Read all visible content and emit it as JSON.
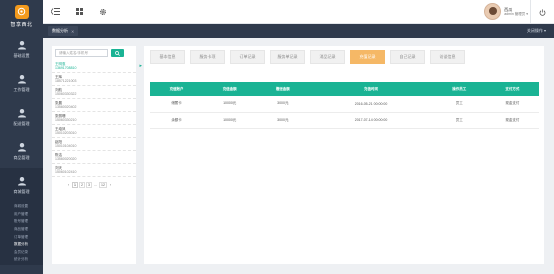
{
  "app": {
    "logo_text": "智享西北"
  },
  "sidebar": {
    "items": [
      {
        "label": "基础设置",
        "icon": "user-icon"
      },
      {
        "label": "工作管理",
        "icon": "user-icon"
      },
      {
        "label": "配送管理",
        "icon": "user-icon"
      },
      {
        "label": "商品管理",
        "icon": "user-icon"
      },
      {
        "label": "商城管理",
        "icon": "user-icon"
      }
    ],
    "submenu": [
      {
        "label": "商城设置",
        "active": false
      },
      {
        "label": "用户管理",
        "active": false
      },
      {
        "label": "账号管理",
        "active": false
      },
      {
        "label": "商品管理",
        "active": false
      },
      {
        "label": "订单管理",
        "active": false
      },
      {
        "label": "数据分析",
        "active": true
      },
      {
        "label": "会员记录",
        "active": false
      },
      {
        "label": "统计分析",
        "active": false
      }
    ]
  },
  "topbar": {
    "user_name": "西瓜",
    "user_role": "admin 管理员"
  },
  "tabbar": {
    "current_tab": "数据分析",
    "close_ops": "关闭操作"
  },
  "left": {
    "search_placeholder": "请输入姓名/手机号",
    "persons": [
      {
        "name": "王明惠",
        "phone": "13691708810"
      },
      {
        "name": "王辉",
        "phone": "18571221003"
      },
      {
        "name": "刘航",
        "phone": "15060330322"
      },
      {
        "name": "张晨",
        "phone": "13560020402"
      },
      {
        "name": "张丽珊",
        "phone": "15060330210"
      },
      {
        "name": "王培凤",
        "phone": "15010203010"
      },
      {
        "name": "赵阳",
        "phone": "15010104010"
      },
      {
        "name": "陈洁",
        "phone": "13560020020"
      },
      {
        "name": "刘天",
        "phone": "15060102410"
      }
    ],
    "pager": [
      "1",
      "2",
      "3",
      "...",
      "12"
    ]
  },
  "right": {
    "tabs": [
      "基本信息",
      "服务卡项",
      "订单记录",
      "服务单记录",
      "消品记录",
      "充值记录",
      "自己记录",
      "访谈信息"
    ],
    "active_tab": 5,
    "table": {
      "headers": [
        "充值账户",
        "充值金额",
        "赠送金额",
        "充值时间",
        "操作员工",
        "支付方式"
      ],
      "rows": [
        [
          "储蓄卡",
          "10000元",
          "3000元",
          "2016-05-21 00:00:00",
          "员工",
          "现金支付"
        ],
        [
          "余额卡",
          "10000元",
          "3000元",
          "2017-07-14 00:00:00",
          "员工",
          "现金支付"
        ]
      ]
    }
  },
  "colors": {
    "accent": "#1ab394",
    "active_tab": "#f5b866",
    "sidebar": "#2f3a4c",
    "logo": "#f39a1d"
  }
}
